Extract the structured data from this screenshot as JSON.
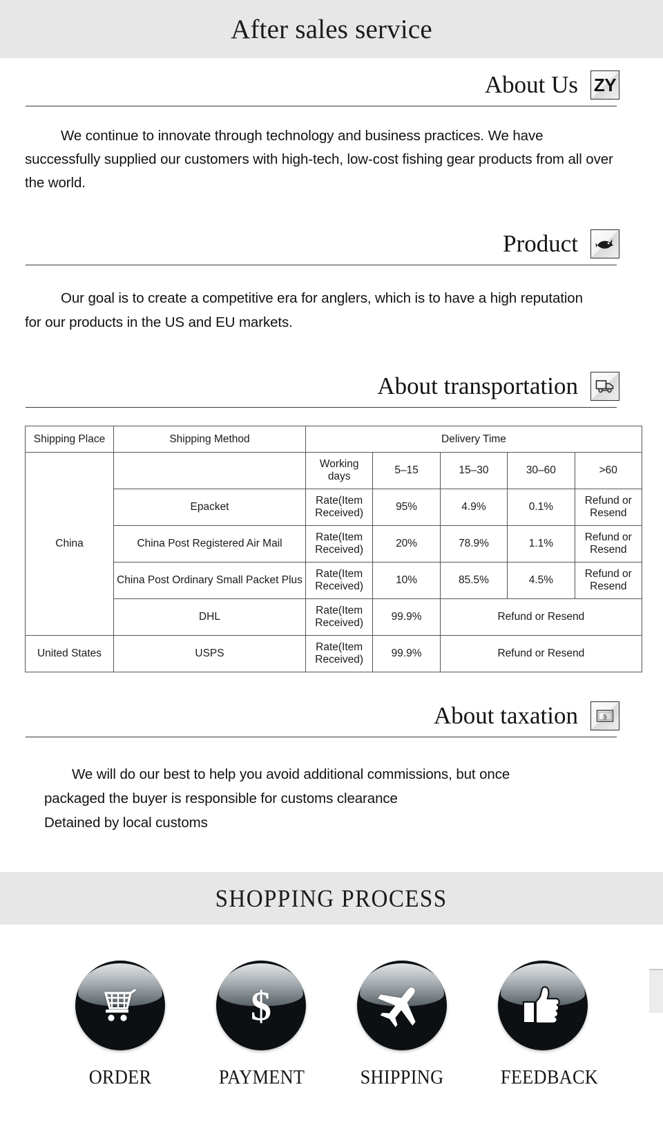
{
  "banner": {
    "top_title": "After sales service",
    "shopping_title": "SHOPPING PROCESS"
  },
  "sections": {
    "about_us": {
      "heading": "About Us",
      "badge_text": "ZY",
      "badge_icon": "zy-logo-icon",
      "body": "We continue to innovate through technology and business practices. We have successfully supplied our customers with high-tech, low-cost fishing gear products from all over the world."
    },
    "product": {
      "heading": "Product",
      "badge_icon": "fish-icon",
      "body": "Our goal is to create a competitive era for anglers, which is to have a high reputation for our products in the US and EU markets."
    },
    "transportation": {
      "heading": "About transportation",
      "badge_icon": "delivery-truck-icon"
    },
    "taxation": {
      "heading": "About taxation",
      "badge_icon": "money-bill-icon",
      "body_line1": "We will do our best to help you avoid additional commissions, but once",
      "body_line2": "packaged the buyer is responsible for customs clearance",
      "body_line3": "Detained by local customs"
    }
  },
  "shipping_table": {
    "headers": {
      "shipping_place": "Shipping Place",
      "shipping_method": "Shipping Method",
      "delivery_time": "Delivery Time"
    },
    "subheaders": {
      "working_days": "Working days",
      "b1": "5–15",
      "b2": "15–30",
      "b3": "30–60",
      "b4": ">60"
    },
    "rows": [
      {
        "place": "China",
        "method": "Epacket",
        "rate_label": "Rate(Item Received)",
        "v1": "95%",
        "v2": "4.9%",
        "v3": "0.1%",
        "v4": "Refund or Resend"
      },
      {
        "place": "",
        "method": "China Post Registered Air Mail",
        "rate_label": "Rate(Item Received)",
        "v1": "20%",
        "v2": "78.9%",
        "v3": "1.1%",
        "v4": "Refund or Resend"
      },
      {
        "place": "",
        "method": "China Post Ordinary Small Packet Plus",
        "rate_label": "Rate(Item Received)",
        "v1": "10%",
        "v2": "85.5%",
        "v3": "4.5%",
        "v4": "Refund or Resend"
      },
      {
        "place": "",
        "method": "DHL",
        "rate_label": "Rate(Item Received)",
        "v1": "99.9%",
        "v_merged": "Refund or Resend"
      },
      {
        "place": "United States",
        "method": "USPS",
        "rate_label": "Rate(Item Received)",
        "v1": "99.9%",
        "v_merged": "Refund or Resend"
      }
    ]
  },
  "shopping_process": {
    "steps": [
      {
        "label": "ORDER",
        "icon": "shopping-cart-icon"
      },
      {
        "label": "PAYMENT",
        "icon": "dollar-sign-icon"
      },
      {
        "label": "SHIPPING",
        "icon": "airplane-icon"
      },
      {
        "label": "FEEDBACK",
        "icon": "thumbs-up-icon"
      }
    ]
  },
  "colors": {
    "band_background": "#e7e7e7",
    "text": "#111111",
    "table_border": "#555555",
    "orb_dark": "#0d1013"
  }
}
